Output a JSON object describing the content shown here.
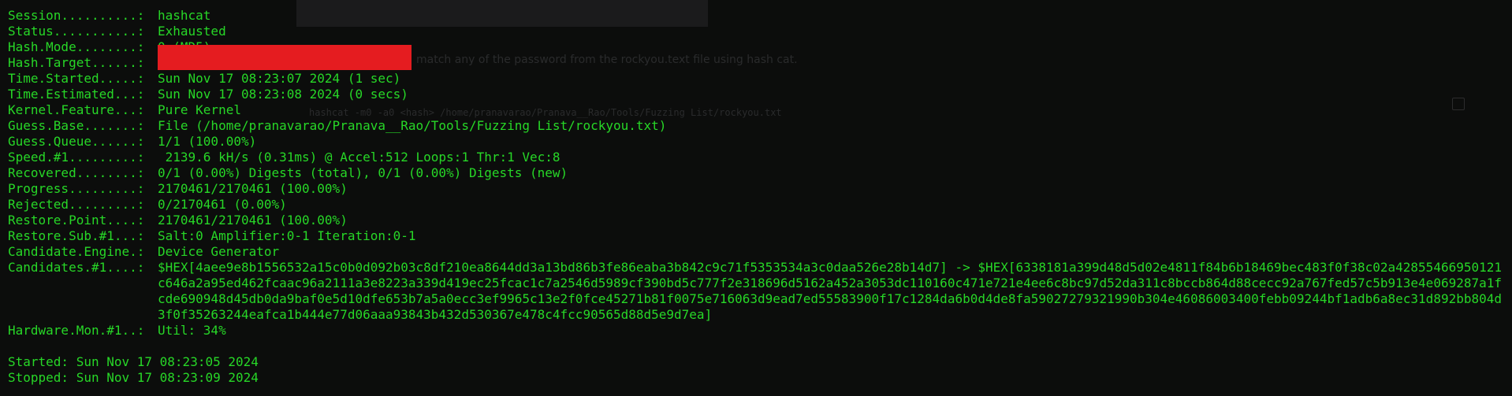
{
  "background": {
    "ghost_line_1": "match any of the password from the rockyou.text file using hash cat.",
    "ghost_line_2": "hashcat -m0 -a0 <hash> /home/pranavarao/Pranava__Rao/Tools/Fuzzing List/rockyou.txt"
  },
  "terminal": {
    "rows": [
      {
        "key": "Session..........:",
        "val": "hashcat"
      },
      {
        "key": "Status...........:",
        "val": "Exhausted"
      },
      {
        "key": "Hash.Mode........:",
        "val": "0 (MD5)"
      },
      {
        "key": "Hash.Target......:",
        "val": ""
      },
      {
        "key": "Time.Started.....:",
        "val": "Sun Nov 17 08:23:07 2024 (1 sec)"
      },
      {
        "key": "Time.Estimated...:",
        "val": "Sun Nov 17 08:23:08 2024 (0 secs)"
      },
      {
        "key": "Kernel.Feature...:",
        "val": "Pure Kernel"
      },
      {
        "key": "Guess.Base.......:",
        "val": "File (/home/pranavarao/Pranava__Rao/Tools/Fuzzing List/rockyou.txt)"
      },
      {
        "key": "Guess.Queue......:",
        "val": "1/1 (100.00%)"
      },
      {
        "key": "Speed.#1.........:",
        "val": " 2139.6 kH/s (0.31ms) @ Accel:512 Loops:1 Thr:1 Vec:8"
      },
      {
        "key": "Recovered........:",
        "val": "0/1 (0.00%) Digests (total), 0/1 (0.00%) Digests (new)"
      },
      {
        "key": "Progress.........:",
        "val": "2170461/2170461 (100.00%)"
      },
      {
        "key": "Rejected.........:",
        "val": "0/2170461 (0.00%)"
      },
      {
        "key": "Restore.Point....:",
        "val": "2170461/2170461 (100.00%)"
      },
      {
        "key": "Restore.Sub.#1...:",
        "val": "Salt:0 Amplifier:0-1 Iteration:0-1"
      },
      {
        "key": "Candidate.Engine.:",
        "val": "Device Generator"
      }
    ],
    "candidates_key": "Candidates.#1....:",
    "candidates_val": "$HEX[4aee9e8b1556532a15c0b0d092b03c8df210ea8644dd3a13bd86b3fe86eaba3b842c9c71f5353534a3c0daa526e28b14d7] -> $HEX[6338181a399d48d5d02e4811f84b6b18469bec483f0f38c02a42855466950121c646a2a95ed462fcaac96a2111a3e8223a339d419ec25fcac1c7a2546d5989cf390bd5c777f2e318696d5162a452a3053dc110160c471e721e4ee6c8bc97d52da311c8bccb864d88cecc92a767fed57c5b913e4e069287a1fcde690948d45db0da9baf0e5d10dfe653b7a5a0ecc3ef9965c13e2f0fce45271b81f0075e716063d9ead7ed55583900f17c1284da6b0d4de8fa59027279321990b304e46086003400febb09244bf1adb6a8ec31d892bb804d3f0f35263244eafca1b444e77d06aaa93843b432d530367e478c4fcc90565d88d5e9d7ea]",
    "hardware_key": "Hardware.Mon.#1..:",
    "hardware_val": "Util: 34%",
    "started": "Started: Sun Nov 17 08:23:05 2024",
    "stopped": "Stopped: Sun Nov 17 08:23:09 2024"
  },
  "colors": {
    "text": "#27d727",
    "background": "#0c0d0c",
    "redaction": "#e51c20"
  }
}
